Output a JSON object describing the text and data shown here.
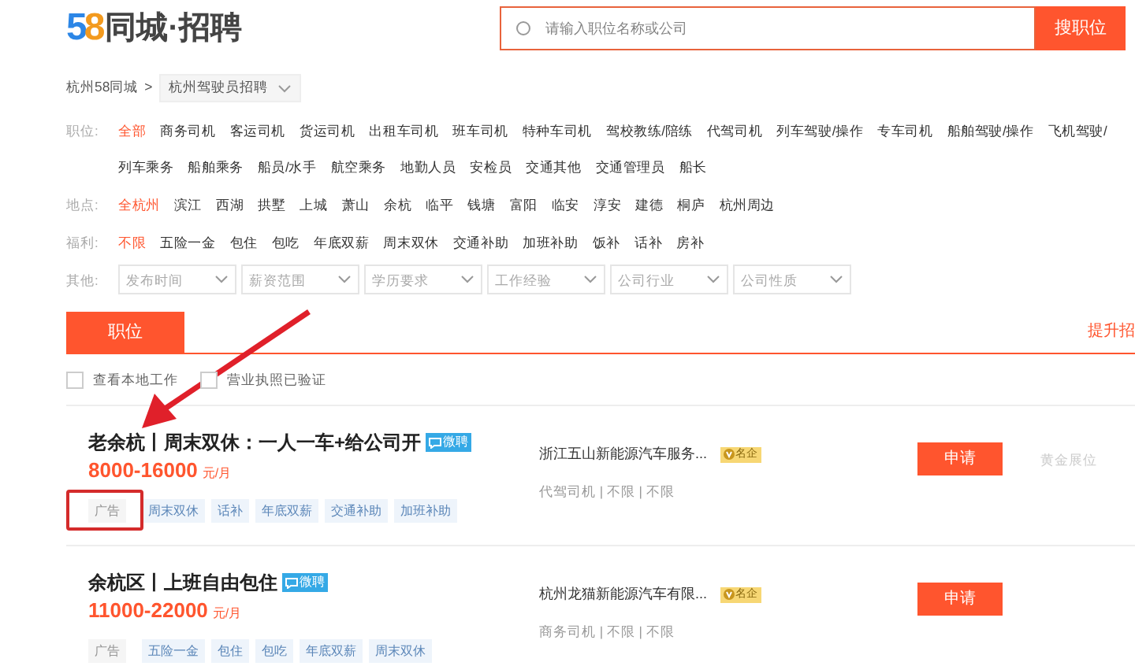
{
  "header": {
    "logo_number": "58",
    "logo_text": "同城·招聘",
    "search": {
      "placeholder": "请输入职位名称或公司",
      "button": "搜职位"
    }
  },
  "breadcrumb": {
    "city": "杭州58同城",
    "separator": ">",
    "current": "杭州驾驶员招聘"
  },
  "filters": [
    {
      "label": "职位:",
      "kind": "links",
      "rows": [
        [
          {
            "text": "全部",
            "selected": true
          },
          {
            "text": "商务司机",
            "selected": false
          },
          {
            "text": "客运司机",
            "selected": false
          },
          {
            "text": "货运司机",
            "selected": false
          },
          {
            "text": "出租车司机",
            "selected": false
          },
          {
            "text": "班车司机",
            "selected": false
          },
          {
            "text": "特种车司机",
            "selected": false
          },
          {
            "text": "驾校教练/陪练",
            "selected": false
          },
          {
            "text": "代驾司机",
            "selected": false
          },
          {
            "text": "列车驾驶/操作",
            "selected": false
          },
          {
            "text": "专车司机",
            "selected": false
          },
          {
            "text": "船舶驾驶/操作",
            "selected": false
          },
          {
            "text": "飞机驾驶/",
            "selected": false
          }
        ],
        [
          {
            "text": "列车乘务",
            "selected": false
          },
          {
            "text": "船舶乘务",
            "selected": false
          },
          {
            "text": "船员/水手",
            "selected": false
          },
          {
            "text": "航空乘务",
            "selected": false
          },
          {
            "text": "地勤人员",
            "selected": false
          },
          {
            "text": "安检员",
            "selected": false
          },
          {
            "text": "交通其他",
            "selected": false
          },
          {
            "text": "交通管理员",
            "selected": false
          },
          {
            "text": "船长",
            "selected": false
          }
        ]
      ]
    },
    {
      "label": "地点:",
      "kind": "links",
      "rows": [
        [
          {
            "text": "全杭州",
            "selected": true
          },
          {
            "text": "滨江",
            "selected": false
          },
          {
            "text": "西湖",
            "selected": false
          },
          {
            "text": "拱墅",
            "selected": false
          },
          {
            "text": "上城",
            "selected": false
          },
          {
            "text": "萧山",
            "selected": false
          },
          {
            "text": "余杭",
            "selected": false
          },
          {
            "text": "临平",
            "selected": false
          },
          {
            "text": "钱塘",
            "selected": false
          },
          {
            "text": "富阳",
            "selected": false
          },
          {
            "text": "临安",
            "selected": false
          },
          {
            "text": "淳安",
            "selected": false
          },
          {
            "text": "建德",
            "selected": false
          },
          {
            "text": "桐庐",
            "selected": false
          },
          {
            "text": "杭州周边",
            "selected": false
          }
        ]
      ]
    },
    {
      "label": "福利:",
      "kind": "links",
      "rows": [
        [
          {
            "text": "不限",
            "selected": true
          },
          {
            "text": "五险一金",
            "selected": false
          },
          {
            "text": "包住",
            "selected": false
          },
          {
            "text": "包吃",
            "selected": false
          },
          {
            "text": "年底双薪",
            "selected": false
          },
          {
            "text": "周末双休",
            "selected": false
          },
          {
            "text": "交通补助",
            "selected": false
          },
          {
            "text": "加班补助",
            "selected": false
          },
          {
            "text": "饭补",
            "selected": false
          },
          {
            "text": "话补",
            "selected": false
          },
          {
            "text": "房补",
            "selected": false
          }
        ]
      ]
    },
    {
      "label": "其他:",
      "kind": "dropdowns",
      "rows": [
        [
          {
            "text": "发布时间"
          },
          {
            "text": "薪资范围"
          },
          {
            "text": "学历要求"
          },
          {
            "text": "工作经验"
          },
          {
            "text": "公司行业"
          },
          {
            "text": "公司性质"
          }
        ]
      ]
    }
  ],
  "tabs": [
    {
      "label": "职位",
      "selected": true
    }
  ],
  "promo_link": "提升招",
  "checkboxes": [
    {
      "label": "查看本地工作",
      "checked": false
    },
    {
      "label": "营业执照已验证",
      "checked": false
    }
  ],
  "jobs": [
    {
      "title": "老余杭丨周末双休：一人一车+给公司开",
      "badge": "微聘",
      "salary": "8000-16000",
      "unit": "元/月",
      "tags": [
        {
          "text": "广告",
          "kind": "ad"
        },
        {
          "text": "周末双休",
          "kind": "welfare"
        },
        {
          "text": "话补",
          "kind": "welfare"
        },
        {
          "text": "年底双薪",
          "kind": "welfare"
        },
        {
          "text": "交通补助",
          "kind": "welfare"
        },
        {
          "text": "加班补助",
          "kind": "welfare"
        }
      ],
      "company": "浙江五山新能源汽车服务...",
      "company_badge": "名企",
      "meta": "代驾司机 | 不限 | 不限",
      "apply": "申请",
      "slot": "黄金展位"
    },
    {
      "title": "余杭区丨上班自由包住",
      "badge": "微聘",
      "salary": "11000-22000",
      "unit": "元/月",
      "tags": [
        {
          "text": "广告",
          "kind": "ad"
        },
        {
          "text": "五险一金",
          "kind": "welfare"
        },
        {
          "text": "包住",
          "kind": "welfare"
        },
        {
          "text": "包吃",
          "kind": "welfare"
        },
        {
          "text": "年底双薪",
          "kind": "welfare"
        },
        {
          "text": "周末双休",
          "kind": "welfare"
        }
      ],
      "company": "杭州龙猫新能源汽车有限...",
      "company_badge": "名企",
      "meta": "商务司机 | 不限 | 不限",
      "apply": "申请"
    }
  ]
}
